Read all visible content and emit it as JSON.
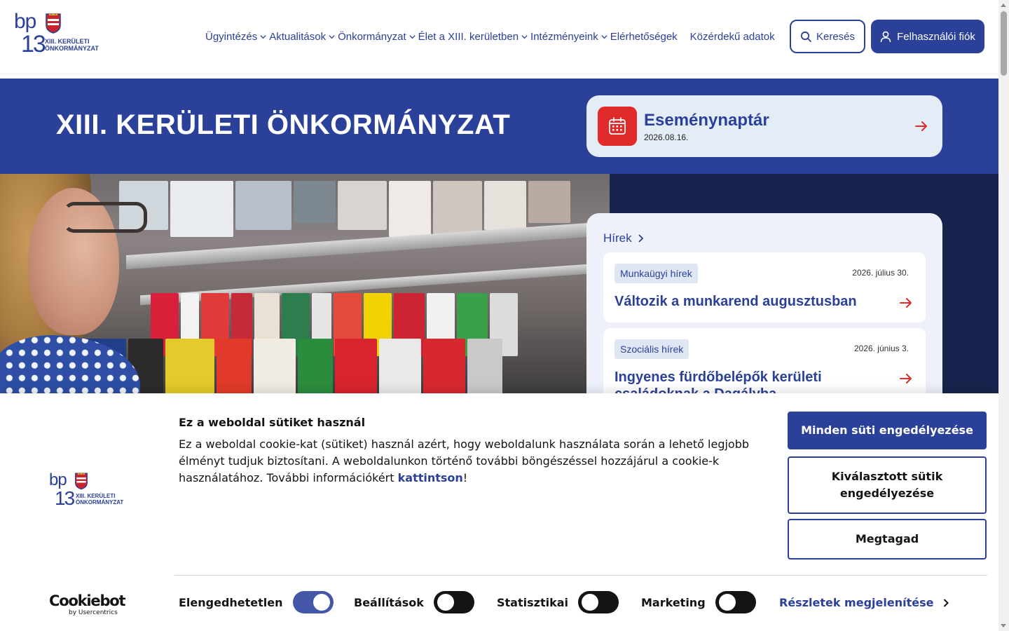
{
  "header": {
    "logo": {
      "bp": "bp",
      "num": "13",
      "line1": "XIII. KERÜLETI",
      "line2": "ÖNKORMÁNYZAT"
    },
    "nav": [
      {
        "label": "Ügyintézés",
        "dropdown": true
      },
      {
        "label": "Aktualitások",
        "dropdown": true
      },
      {
        "label": "Önkormányzat",
        "dropdown": true
      },
      {
        "label": "Élet a XIII. kerületben",
        "dropdown": true
      },
      {
        "label": "Intézményeink",
        "dropdown": true
      },
      {
        "label": "Elérhetőségek",
        "dropdown": false
      },
      {
        "label": "Közérdekű adatok",
        "dropdown": false
      }
    ],
    "search_label": "Keresés",
    "account_label": "Felhasználói fiók"
  },
  "banner": {
    "title": "XIII. KERÜLETI ÖNKORMÁNYZAT",
    "event": {
      "title": "Eseménynaptár",
      "date": "2026.08.16."
    }
  },
  "news": {
    "heading": "Hírek",
    "items": [
      {
        "tag": "Munkaügyi hírek",
        "date": "2026. július 30.",
        "title": "Változik a munkarend augusztusban"
      },
      {
        "tag": "Szociális hírek",
        "date": "2026. június 3.",
        "title": "Ingyenes fürdőbelépők kerületi családoknak a Dagályba"
      }
    ]
  },
  "cookie": {
    "logo": {
      "bp": "bp",
      "num": "13",
      "line1": "XIII. KERÜLETI",
      "line2": "ÖNKORMÁNYZAT"
    },
    "title": "Ez a weboldal sütiket használ",
    "text_before": "Ez a weboldal cookie-kat (sütiket) használ azért, hogy weboldalunk használata során a lehető legjobb élményt tudjuk biztosítani. A weboldalunkon történő további böngészéssel hozzájárul a cookie-k használatához. További információkért ",
    "link": "kattintson",
    "text_after": "!",
    "allow_all": "Minden süti engedélyezése",
    "allow_selected": "Kiválasztott sütik engedélyezése",
    "deny": "Megtagad",
    "brand": {
      "main": "Cookiebot",
      "sub": "by Usercentrics"
    },
    "toggles": [
      {
        "label": "Elengedhetetlen",
        "on": true
      },
      {
        "label": "Beállítások",
        "on": false
      },
      {
        "label": "Statisztikai",
        "on": false
      },
      {
        "label": "Marketing",
        "on": false
      }
    ],
    "details": "Részletek megjelenítése"
  },
  "colors": {
    "brand_blue": "#2b4199",
    "accent_red": "#e12a2a",
    "banner_bg": "#2b4199",
    "hero_dark": "#17244d"
  }
}
